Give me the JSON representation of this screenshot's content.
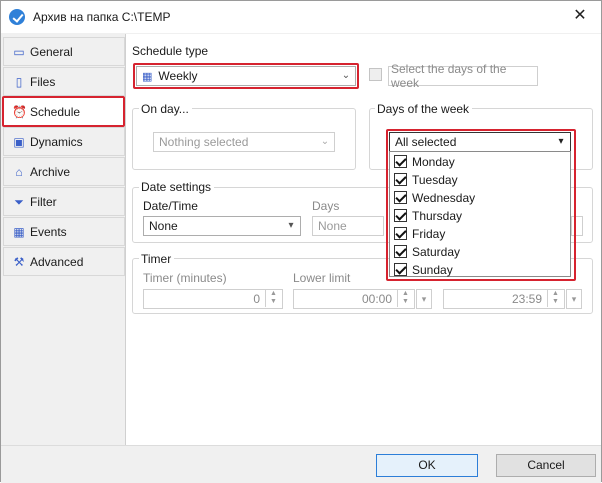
{
  "window": {
    "title": "Архив на папка C:\\TEMP",
    "close_symbol": "✕"
  },
  "sidebar": {
    "items": [
      {
        "label": "General",
        "icon": "monitor-icon",
        "glyph": "▭",
        "active": false
      },
      {
        "label": "Files",
        "icon": "file-icon",
        "glyph": "▯",
        "active": false
      },
      {
        "label": "Schedule",
        "icon": "alarm-clock-icon",
        "glyph": "⏰",
        "active": true
      },
      {
        "label": "Dynamics",
        "icon": "dynamics-icon",
        "glyph": "▣",
        "active": false
      },
      {
        "label": "Archive",
        "icon": "archive-icon",
        "glyph": "⌂",
        "active": false
      },
      {
        "label": "Filter",
        "icon": "filter-icon",
        "glyph": "⏷",
        "active": false
      },
      {
        "label": "Events",
        "icon": "calendar-icon",
        "glyph": "▦",
        "active": false
      },
      {
        "label": "Advanced",
        "icon": "wrench-icon",
        "glyph": "⚒",
        "active": false
      }
    ]
  },
  "schedule": {
    "type_label": "Schedule type",
    "type_value": "Weekly",
    "select_days_label": "Select the days of the week",
    "on_day": {
      "title": "On day...",
      "value": "Nothing selected"
    },
    "days_of_week": {
      "title": "Days of the week",
      "value": "All selected",
      "options": [
        {
          "label": "Monday",
          "checked": true
        },
        {
          "label": "Tuesday",
          "checked": true
        },
        {
          "label": "Wednesday",
          "checked": true
        },
        {
          "label": "Thursday",
          "checked": true
        },
        {
          "label": "Friday",
          "checked": true
        },
        {
          "label": "Saturday",
          "checked": true
        },
        {
          "label": "Sunday",
          "checked": true
        }
      ]
    },
    "date_settings": {
      "title": "Date settings",
      "datetime_label": "Date/Time",
      "datetime_value": "None",
      "days_label": "Days",
      "days_value": "None"
    },
    "timer": {
      "title": "Timer",
      "minutes_label": "Timer (minutes)",
      "minutes_value": "0",
      "lower_label": "Lower limit",
      "lower_value": "00:00",
      "upper_value": "23:59"
    }
  },
  "footer": {
    "ok_label": "OK",
    "cancel_label": "Cancel"
  },
  "colors": {
    "highlight": "#d6232f",
    "accent": "#2c7ed8"
  }
}
